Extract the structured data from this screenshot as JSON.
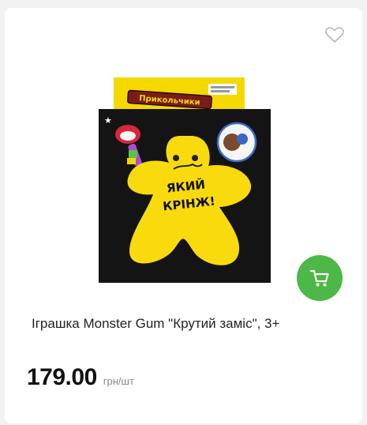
{
  "product": {
    "title": "Іграшка Monster Gum \"Крутий заміс\", 3+",
    "price": "179.00",
    "unit": "грн/шт",
    "image": {
      "header_text": "Прикольчики",
      "sticker_text": "ЯКИЙ",
      "sticker_text2": "КРІНЖ!"
    }
  },
  "icons": {
    "favorite": "heart-outline-icon",
    "cart": "cart-icon"
  },
  "colors": {
    "cart_button": "#4cb847",
    "package_yellow": "#f5d800",
    "package_black": "#141414"
  }
}
